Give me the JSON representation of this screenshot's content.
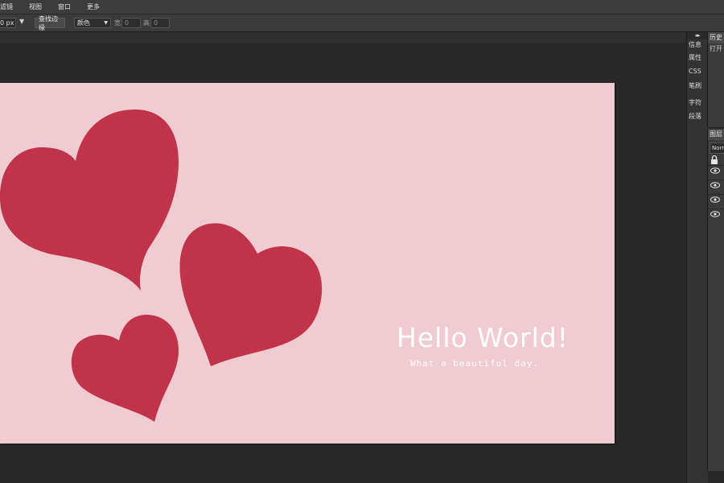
{
  "menu": {
    "items": [
      "滤镜",
      "视图",
      "窗口",
      "更多"
    ]
  },
  "options": {
    "size_value": "0",
    "size_unit": "px",
    "find_edges_label": "查找边缘",
    "mode_select": "颜色",
    "width_label": "宽",
    "width_value": "0",
    "height_label": "高",
    "height_value": "0"
  },
  "canvas": {
    "background_color": "#f0cbd2",
    "heart_color": "#c03348",
    "title": "Hello World!",
    "subtitle": "What a beautiful day."
  },
  "side_icons": {
    "collapse": "◂▸",
    "items": [
      "信息",
      "属性",
      "CSS",
      "笔刷",
      "字符",
      "段落"
    ]
  },
  "history_panel": {
    "tab": "历史",
    "row": "打开"
  },
  "layers_panel": {
    "tab": "图层",
    "blend_mode": "Normal"
  }
}
